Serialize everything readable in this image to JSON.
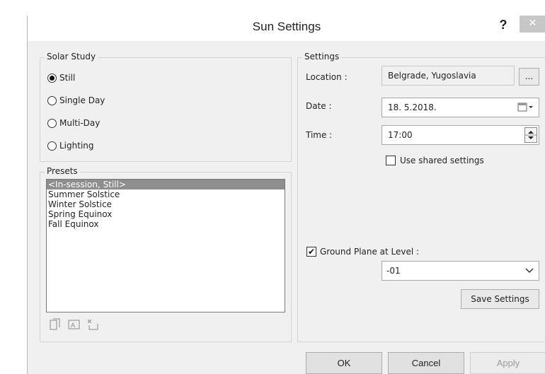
{
  "dialog": {
    "title": "Sun Settings",
    "help_glyph": "?",
    "close_glyph": "✕"
  },
  "solar_study": {
    "label": "Solar Study",
    "options": [
      {
        "label": "Still",
        "selected": true
      },
      {
        "label": "Single Day",
        "selected": false
      },
      {
        "label": "Multi-Day",
        "selected": false
      },
      {
        "label": "Lighting",
        "selected": false
      }
    ]
  },
  "presets": {
    "label": "Presets",
    "items": [
      "<In-session, Still>",
      "Summer Solstice",
      "Winter Solstice",
      "Spring Equinox",
      "Fall Equinox"
    ],
    "selected_index": 0,
    "toolbar_icons": [
      "duplicate-preset-icon",
      "rename-preset-icon",
      "delete-preset-icon"
    ]
  },
  "settings": {
    "label": "Settings",
    "location_label": "Location :",
    "location_value": "Belgrade, Yugoslavia",
    "location_browse": "...",
    "date_label": "Date :",
    "date_value": "18.  5.2018.",
    "time_label": "Time :",
    "time_value": "17:00",
    "use_shared_label": "Use shared settings",
    "use_shared_checked": false,
    "ground_plane_label": "Ground Plane at Level :",
    "ground_plane_checked": true,
    "level_value": "-01",
    "save_settings_label": "Save Settings"
  },
  "footer": {
    "ok_label": "OK",
    "cancel_label": "Cancel",
    "apply_label": "Apply"
  }
}
